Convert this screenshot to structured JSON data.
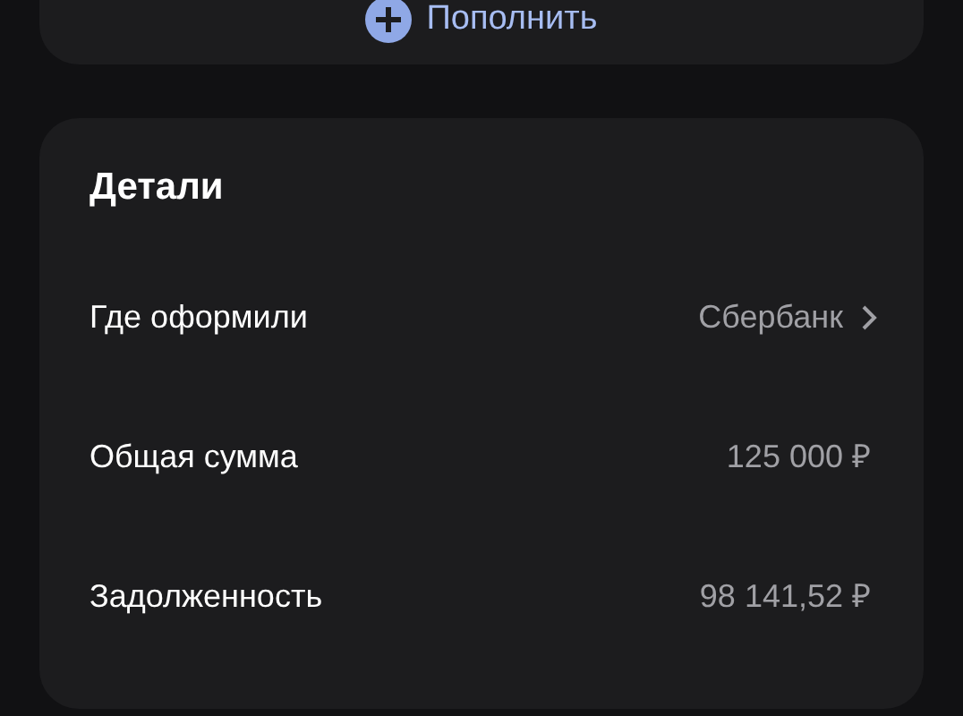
{
  "top_action": {
    "label": "Пополнить"
  },
  "details": {
    "title": "Детали",
    "rows": [
      {
        "label": "Где оформили",
        "value": "Сбербанк",
        "link": true
      },
      {
        "label": "Общая сумма",
        "value": "125 000 ₽",
        "link": false
      },
      {
        "label": "Задолженность",
        "value": "98 141,52 ₽",
        "link": false
      }
    ]
  }
}
